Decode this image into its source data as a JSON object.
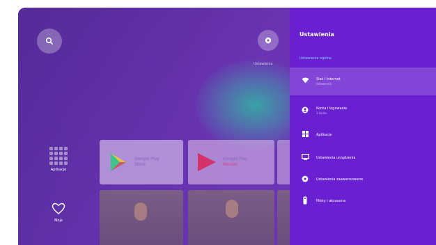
{
  "home": {
    "profile_label": "Ustawienia",
    "side": {
      "apps_label": "Aplikacje",
      "favorites_label": "Moje"
    },
    "cards": [
      {
        "title": "Google Play",
        "subtitle": "Store"
      },
      {
        "title": "Google Play",
        "subtitle": "Movies"
      }
    ]
  },
  "panel": {
    "title": "Ustawienia",
    "section": "Ustawienia ogólne",
    "items": [
      {
        "label": "Sieć i Internet",
        "secondary": "Ustawienia",
        "icon": "wifi-icon"
      },
      {
        "label": "Konta i logowanie",
        "secondary": "1 konto",
        "icon": "account-icon"
      },
      {
        "label": "Aplikacje",
        "secondary": "",
        "icon": "apps-icon"
      },
      {
        "label": "Ustawienia urządzenia",
        "secondary": "",
        "icon": "display-icon"
      },
      {
        "label": "Ustawienia zaawansowane",
        "secondary": "",
        "icon": "advanced-settings-icon"
      },
      {
        "label": "Piloty i akcesoria",
        "secondary": "",
        "icon": "remote-icon"
      }
    ]
  },
  "colors": {
    "panel": "#6a1fd0",
    "background": "#6b35b5",
    "accent_section": "#7ed0ff",
    "movies_accent": "#dc326e"
  }
}
